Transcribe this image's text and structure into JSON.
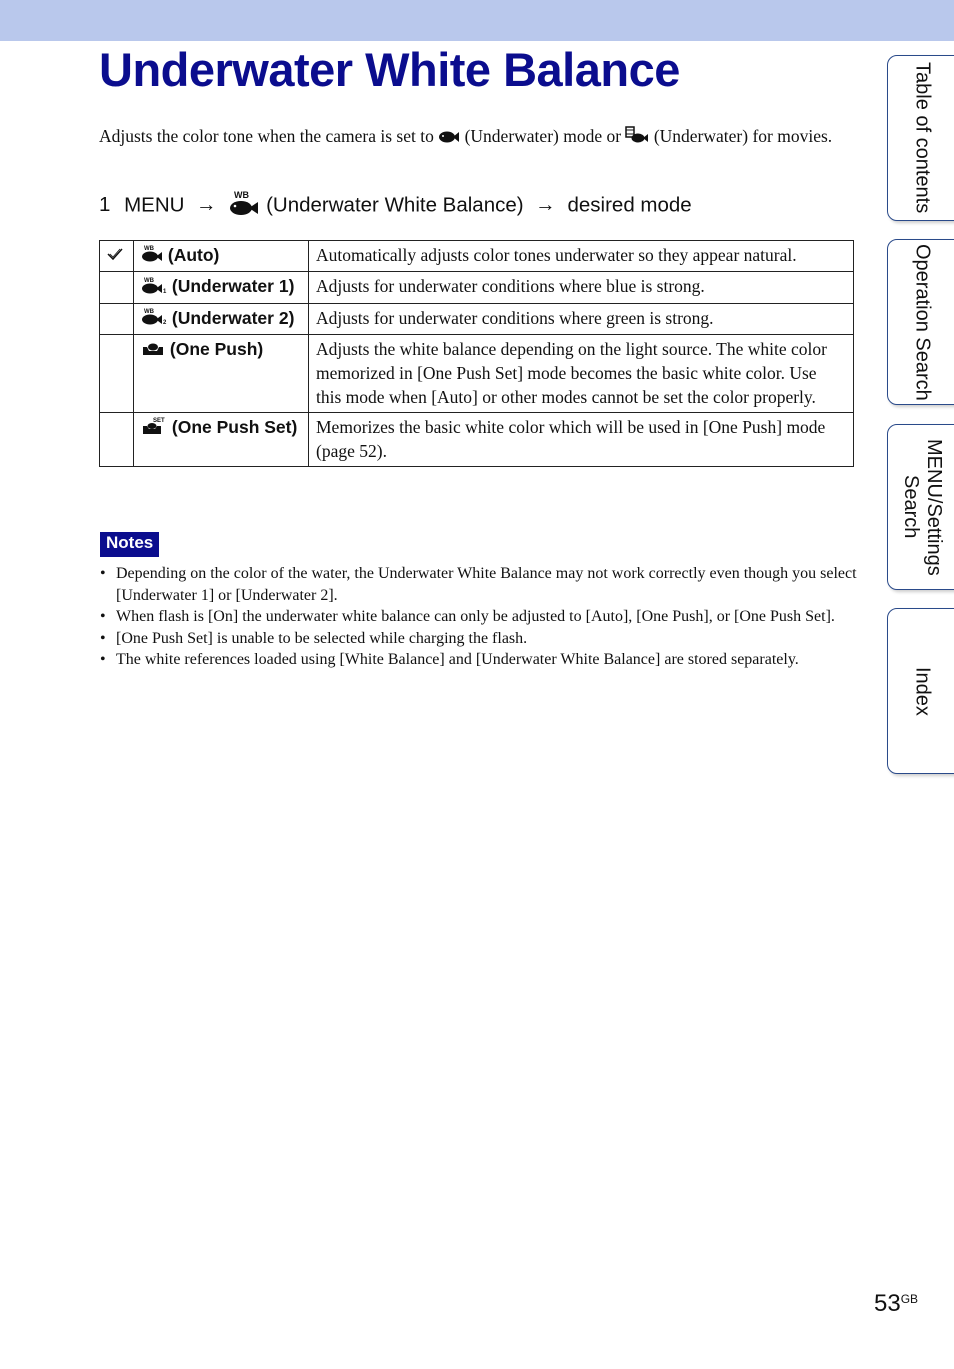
{
  "page": {
    "title": "Underwater White Balance",
    "intro": {
      "part1": "Adjusts the color tone when the camera is set to",
      "icon1": "underwater-mode-icon",
      "part2": "(Underwater) mode or",
      "icon2": "underwater-movie-icon",
      "part3": "(Underwater) for movies."
    },
    "step": {
      "number": "1",
      "menu": "MENU",
      "arrow": "→",
      "icon": "underwater-white-balance-icon",
      "item": "(Underwater White Balance)",
      "target": "desired mode"
    },
    "table": {
      "rows": [
        {
          "default": true,
          "icon": "wb-auto-icon",
          "name": "(Auto)",
          "description": "Automatically adjusts color tones underwater so they appear natural."
        },
        {
          "default": false,
          "icon": "wb-underwater-1-icon",
          "name": "(Underwater 1)",
          "description": "Adjusts for underwater conditions where blue is strong."
        },
        {
          "default": false,
          "icon": "wb-underwater-2-icon",
          "name": "(Underwater 2)",
          "description": "Adjusts for underwater conditions where green is strong."
        },
        {
          "default": false,
          "icon": "one-push-icon",
          "name": "(One Push)",
          "description": "Adjusts the white balance depending on the light source. The white color memorized in [One Push Set] mode becomes the basic white color. Use this mode when [Auto] or other modes cannot be set the color properly."
        },
        {
          "default": false,
          "icon": "one-push-set-icon",
          "name": "(One Push Set)",
          "description": "Memorizes the basic white color which will be used in [One Push] mode (page 52)."
        }
      ]
    },
    "notes": {
      "label": "Notes",
      "items": [
        "Depending on the color of the water, the Underwater White Balance may not work correctly even though you select [Underwater 1] or [Underwater 2].",
        "When flash is [On] the underwater white balance can only be adjusted to [Auto], [One Push], or [One Push Set].",
        "[One Push Set] is unable to be selected while charging the flash.",
        "The white references loaded using [White Balance] and [Underwater White Balance] are stored separately."
      ]
    },
    "side_tabs": [
      {
        "label": "Table of contents"
      },
      {
        "label": "Operation Search"
      },
      {
        "label": "MENU/Settings Search"
      },
      {
        "label": "Index"
      }
    ],
    "page_number": "53",
    "page_suffix": "GB",
    "colors": {
      "title": "#0b0d8e",
      "top_bar": "#b9c8ec",
      "notes_badge": "#0b0d8e",
      "tab_border": "#2a4a8a"
    }
  }
}
